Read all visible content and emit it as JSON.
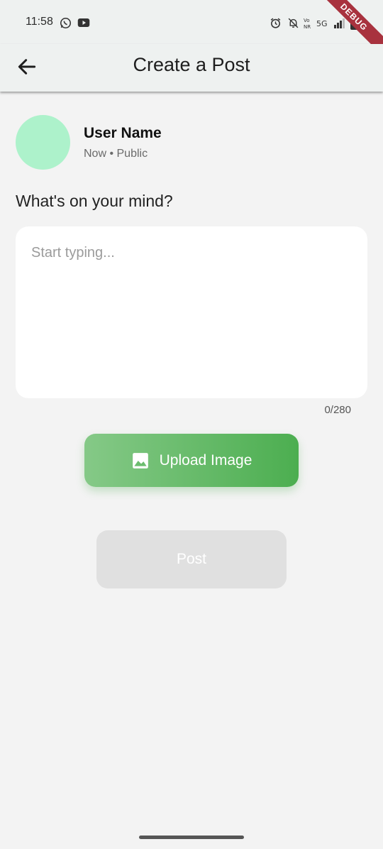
{
  "status_bar": {
    "time": "11:58",
    "network": "5G"
  },
  "debug_banner": "DEBUG",
  "app_bar": {
    "title": "Create a Post"
  },
  "user": {
    "name": "User Name",
    "meta": "Now • Public",
    "avatar_color": "#adf2cb"
  },
  "composer": {
    "prompt": "What's on your mind?",
    "placeholder": "Start typing...",
    "value": "",
    "counter": "0/280"
  },
  "buttons": {
    "upload_label": "Upload Image",
    "post_label": "Post"
  },
  "colors": {
    "accent_green": "#4cae50",
    "post_disabled_bg": "#e0e0e0"
  }
}
